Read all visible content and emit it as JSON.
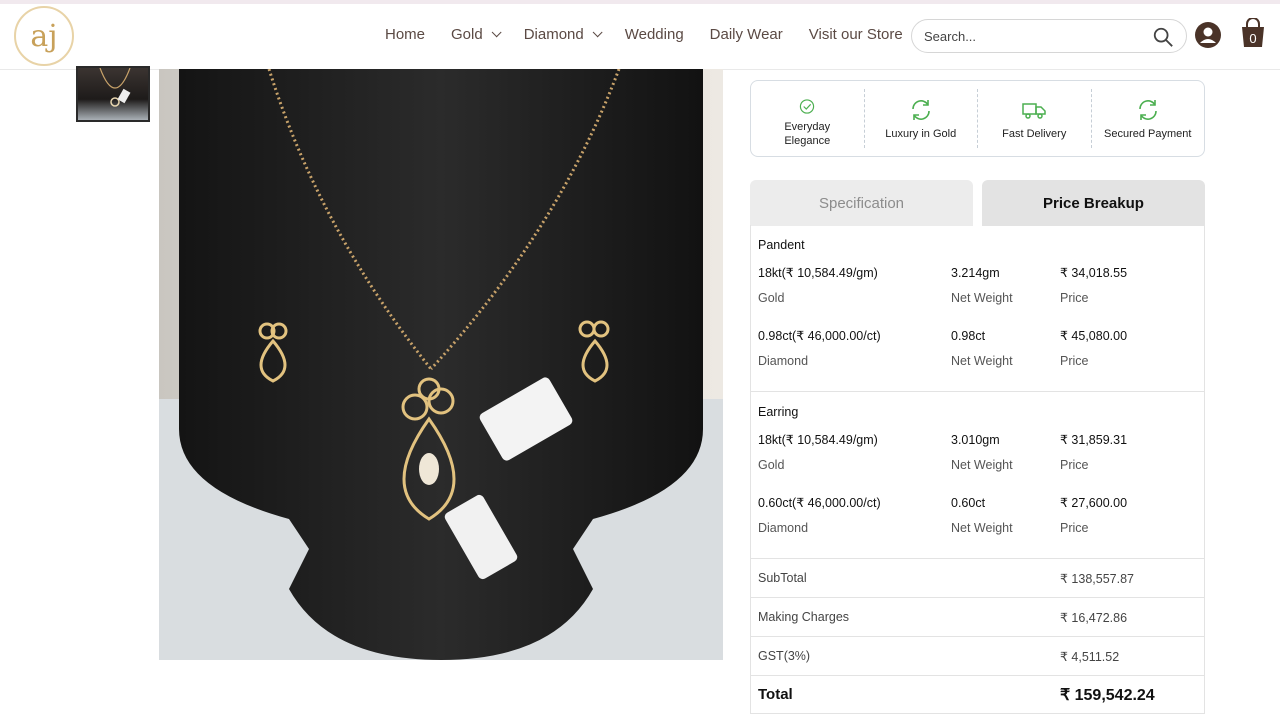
{
  "header": {
    "logo_text": "aj",
    "nav": [
      {
        "label": "Home",
        "dropdown": false
      },
      {
        "label": "Gold",
        "dropdown": true
      },
      {
        "label": "Diamond",
        "dropdown": true
      },
      {
        "label": "Wedding",
        "dropdown": false
      },
      {
        "label": "Daily Wear",
        "dropdown": false
      },
      {
        "label": "Visit our Store",
        "dropdown": false
      }
    ],
    "search_placeholder": "Search...",
    "cart_count": "0"
  },
  "colors": {
    "accent": "#5b4a44",
    "icon_green": "#4caf50",
    "gold": "#c8a15a"
  },
  "features": [
    {
      "label": "Everyday Elegance",
      "icon": "check-badge-icon"
    },
    {
      "label": "Luxury in Gold",
      "icon": "refresh-icon"
    },
    {
      "label": "Fast Delivery",
      "icon": "truck-icon"
    },
    {
      "label": "Secured Payment",
      "icon": "refresh-icon"
    }
  ],
  "tabs": {
    "specification": "Specification",
    "price_breakup": "Price Breakup"
  },
  "breakup": {
    "sections": [
      {
        "title": "Pandent",
        "rows": [
          {
            "rate": "18kt(₹ 10,584.49/gm)",
            "type": "Gold",
            "weight": "3.214gm",
            "weight_label": "Net Weight",
            "price": "₹ 34,018.55",
            "price_label": "Price"
          },
          {
            "rate": "0.98ct(₹ 46,000.00/ct)",
            "type": "Diamond",
            "weight": "0.98ct",
            "weight_label": "Net Weight",
            "price": "₹ 45,080.00",
            "price_label": "Price"
          }
        ]
      },
      {
        "title": "Earring",
        "rows": [
          {
            "rate": "18kt(₹ 10,584.49/gm)",
            "type": "Gold",
            "weight": "3.010gm",
            "weight_label": "Net Weight",
            "price": "₹ 31,859.31",
            "price_label": "Price"
          },
          {
            "rate": "0.60ct(₹ 46,000.00/ct)",
            "type": "Diamond",
            "weight": "0.60ct",
            "weight_label": "Net Weight",
            "price": "₹ 27,600.00",
            "price_label": "Price"
          }
        ]
      }
    ],
    "subtotal": {
      "label": "SubTotal",
      "value": "₹ 138,557.87"
    },
    "making": {
      "label": "Making Charges",
      "value": "₹ 16,472.86"
    },
    "gst": {
      "label": "GST(3%)",
      "value": "₹ 4,511.52"
    },
    "total": {
      "label": "Total",
      "value": "₹ 159,542.24"
    }
  }
}
